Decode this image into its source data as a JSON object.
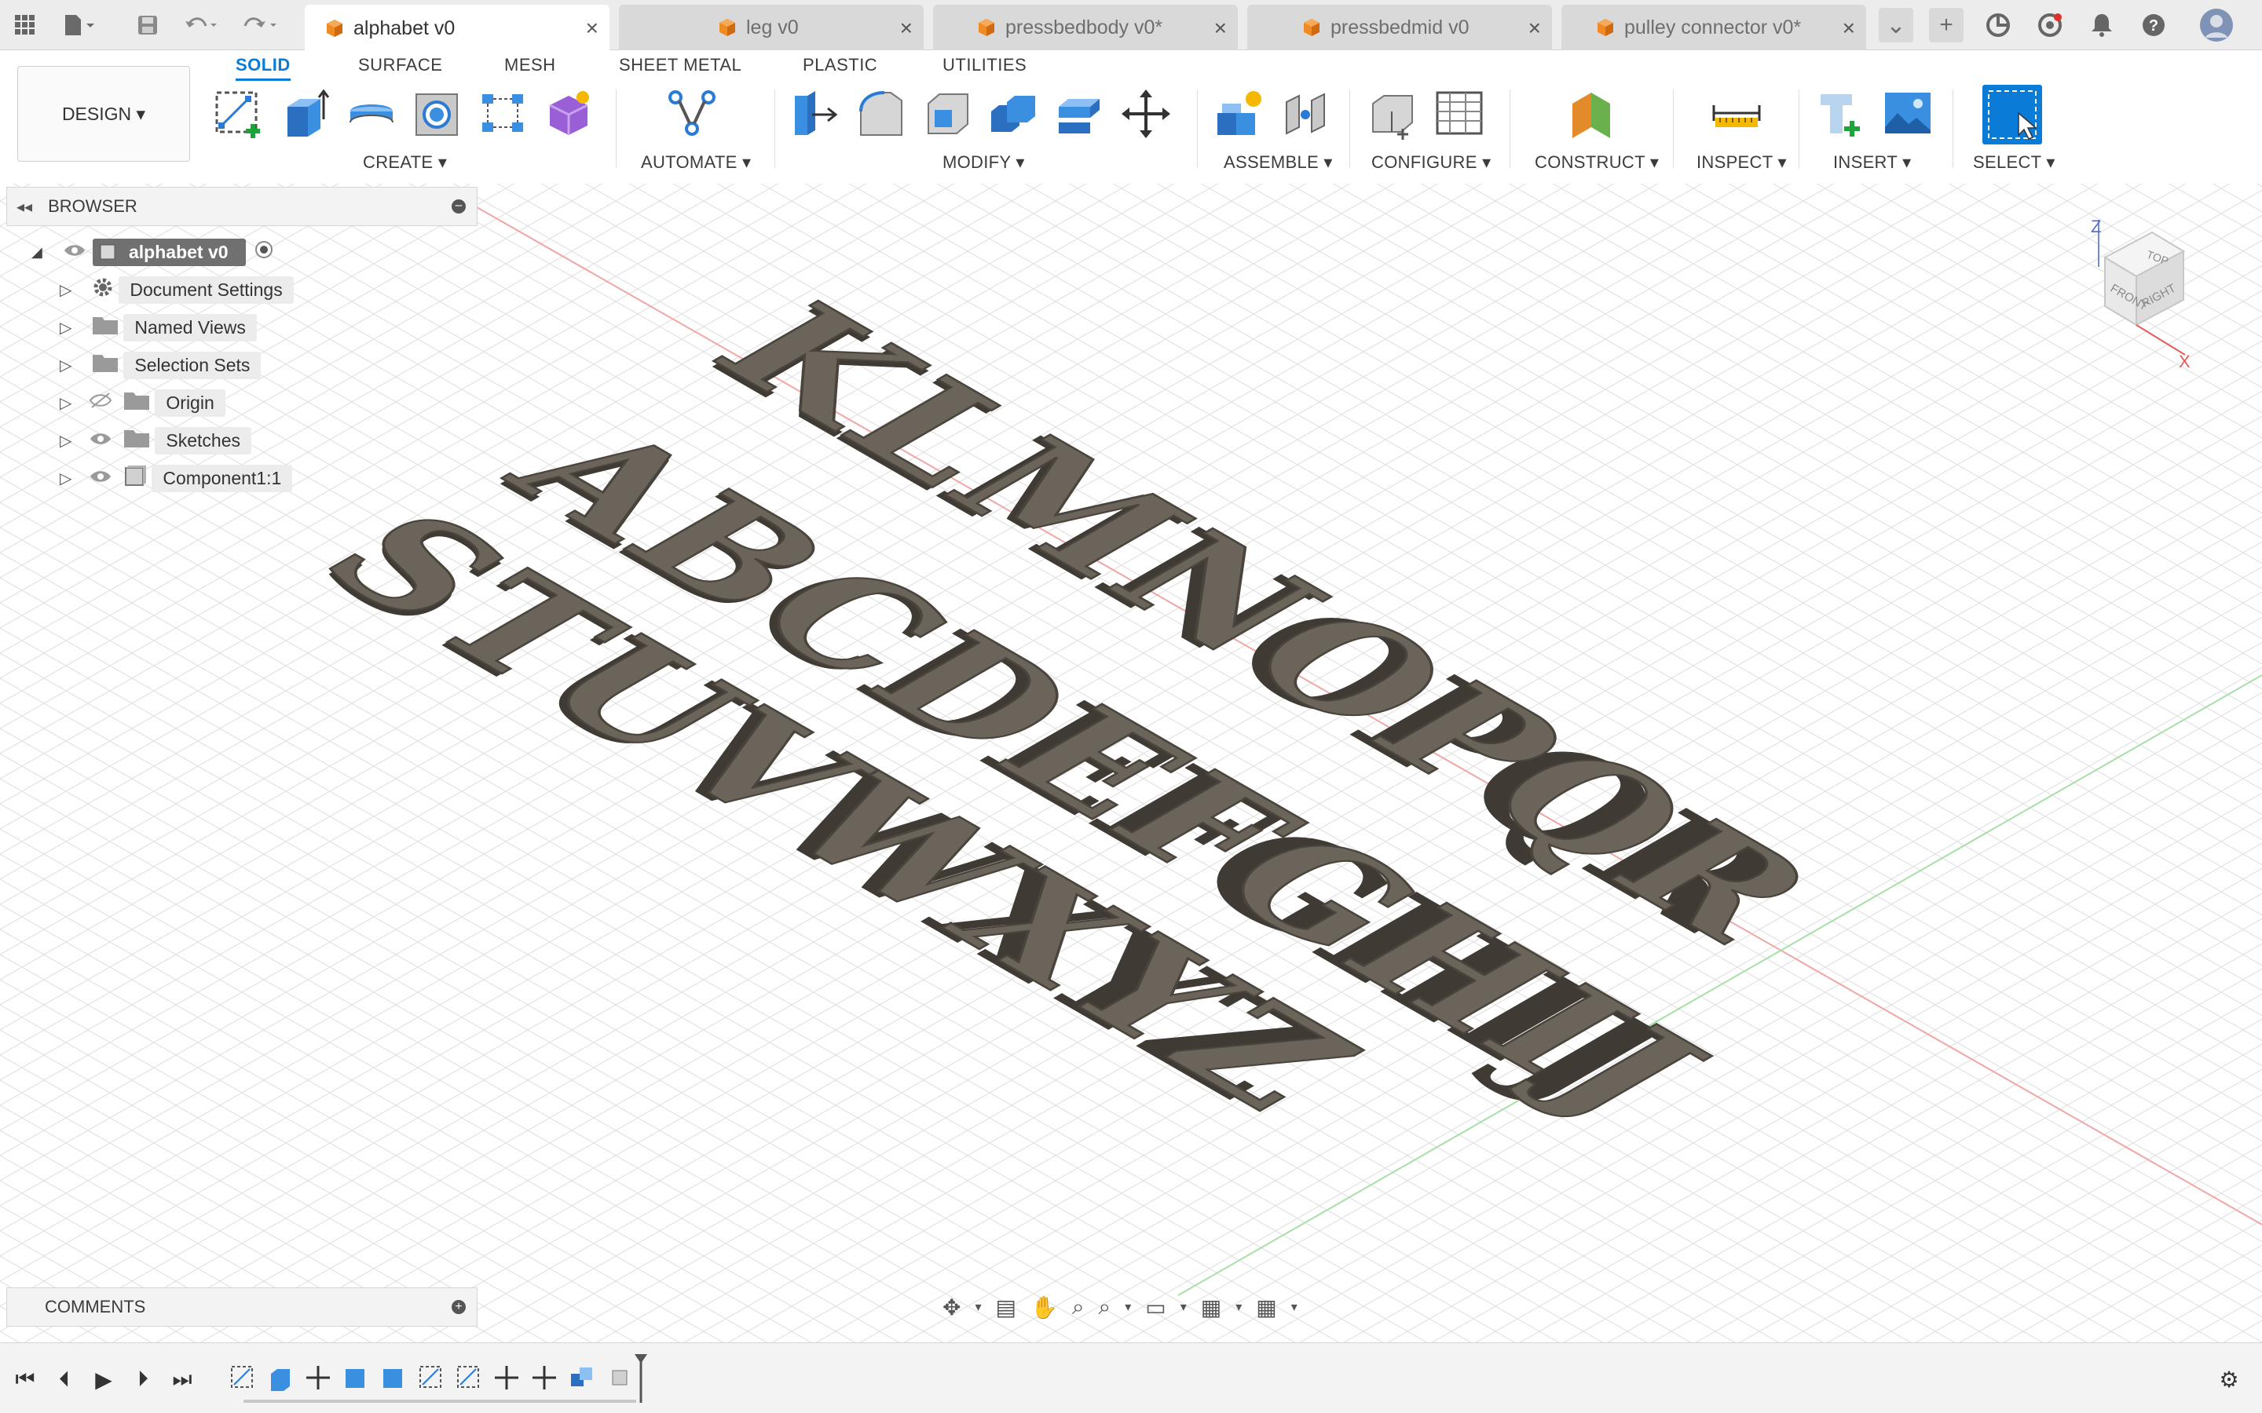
{
  "tabs": [
    {
      "label": "alphabet v0",
      "active": true
    },
    {
      "label": "leg v0",
      "active": false
    },
    {
      "label": "pressbedbody v0*",
      "active": false
    },
    {
      "label": "pressbedmid v0",
      "active": false
    },
    {
      "label": "pulley connector v0*",
      "active": false
    }
  ],
  "workspace_tabs": [
    "SOLID",
    "SURFACE",
    "MESH",
    "SHEET METAL",
    "PLASTIC",
    "UTILITIES"
  ],
  "design_button": "DESIGN ▾",
  "groups": {
    "create": "CREATE ▾",
    "automate": "AUTOMATE ▾",
    "modify": "MODIFY ▾",
    "assemble": "ASSEMBLE ▾",
    "configure": "CONFIGURE ▾",
    "construct": "CONSTRUCT ▾",
    "inspect": "INSPECT ▾",
    "insert": "INSERT ▾",
    "select": "SELECT ▾"
  },
  "browser": {
    "title": "BROWSER",
    "root": "alphabet v0",
    "items": [
      {
        "label": "Document Settings",
        "icon": "gear-icon"
      },
      {
        "label": "Named Views",
        "icon": "folder-icon"
      },
      {
        "label": "Selection Sets",
        "icon": "folder-icon"
      },
      {
        "label": "Origin",
        "icon": "folder-icon"
      },
      {
        "label": "Sketches",
        "icon": "folder-icon"
      },
      {
        "label": "Component1:1",
        "icon": "component-icon"
      }
    ]
  },
  "comments": {
    "title": "COMMENTS"
  },
  "model": {
    "row1": "KLMNOPQR",
    "row2": "ABCDEFGHIJ",
    "row3": "STUVWXYZ",
    "color": "#6b645b"
  },
  "viewcube": {
    "top": "TOP",
    "front": "FRONT",
    "right": "RIGHT",
    "z": "Z",
    "x": "X"
  },
  "colors": {
    "accent": "#0a7bd6",
    "brand_orange": "#f08a24"
  }
}
